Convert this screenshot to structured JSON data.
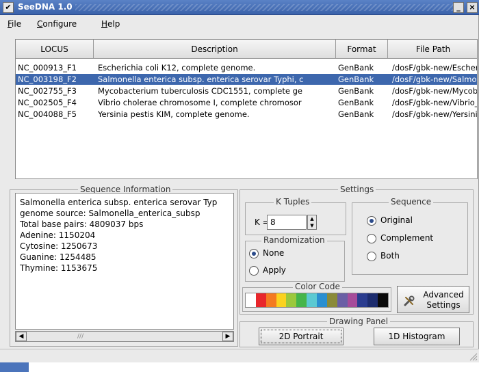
{
  "window": {
    "title": "SeeDNA 1.0",
    "menu_glyph": "✔",
    "min_glyph": "_",
    "close_glyph": "×"
  },
  "menu": [
    {
      "mnemonic": "F",
      "rest": "ile"
    },
    {
      "mnemonic": "C",
      "rest": "onfigure"
    },
    {
      "mnemonic": "H",
      "rest": "elp"
    }
  ],
  "table": {
    "headers": [
      "LOCUS",
      "Description",
      "Format",
      "File Path"
    ],
    "rows": [
      [
        "NC_000913_F1",
        "Escherichia coli K12, complete genome.",
        "GenBank",
        "/dosF/gbk-new/Escheric"
      ],
      [
        "NC_003198_F2",
        "Salmonella enterica subsp. enterica serovar Typhi, c",
        "GenBank",
        "/dosF/gbk-new/Salmone"
      ],
      [
        "NC_002755_F3",
        "Mycobacterium tuberculosis CDC1551, complete ge",
        "GenBank",
        "/dosF/gbk-new/Mycoba"
      ],
      [
        "NC_002505_F4",
        "Vibrio cholerae chromosome I, complete chromosor",
        "GenBank",
        "/dosF/gbk-new/Vibrio_c"
      ],
      [
        "NC_004088_F5",
        "Yersinia pestis KIM, complete genome.",
        "GenBank",
        "/dosF/gbk-new/Yersinia"
      ]
    ],
    "selected_index": 1
  },
  "sequence_info": {
    "label": "Sequence Information",
    "lines": [
      "Salmonella enterica subsp. enterica serovar Typ",
      "genome source: Salmonella_enterica_subsp",
      "Total base pairs: 4809037 bps",
      "Adenine:  1150204",
      "Cytosine:  1250673",
      "Guanine:  1254485",
      "Thymine:  1153675"
    ],
    "scroll_left": "◀",
    "scroll_right": "▶",
    "scroll_grip": "///"
  },
  "settings": {
    "label": "Settings",
    "ktuples": {
      "label": "K Tuples",
      "prefix": "K =",
      "value": "8",
      "up": "▲",
      "down": "▼"
    },
    "randomization": {
      "label": "Randomization",
      "options": [
        "None",
        "Apply"
      ],
      "selected": 0
    },
    "sequence": {
      "label": "Sequence",
      "options": [
        "Original",
        "Complement",
        "Both"
      ],
      "selected": 0
    },
    "color_code": {
      "label": "Color Code",
      "colors": [
        "#ffffff",
        "#e8262b",
        "#f47a20",
        "#fbd21f",
        "#9bc83c",
        "#45b54a",
        "#5bc9d2",
        "#2a8fd1",
        "#8a8a3a",
        "#6a5fa5",
        "#a64c9a",
        "#2a3c8f",
        "#1c2c6e",
        "#0a0a0a"
      ]
    },
    "advanced_button": {
      "line1": "Advanced",
      "line2": "Settings"
    }
  },
  "drawing_panel": {
    "label": "Drawing Panel",
    "buttons": [
      "2D Portrait",
      "1D Histogram"
    ]
  }
}
